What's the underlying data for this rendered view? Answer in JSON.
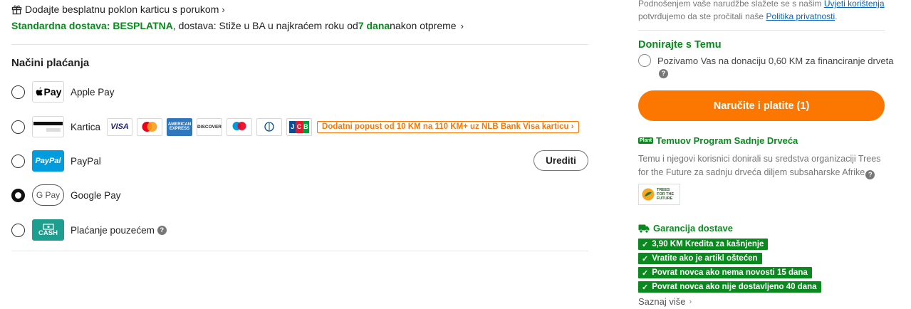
{
  "gift": {
    "label": "Dodajte besplatnu poklon karticu s porukom",
    "chevron": "›"
  },
  "shipping": {
    "prefix": "Standardna dostava: BESPLATNA",
    "middle": ", dostava: Stiže u BA u najkraćem roku od ",
    "days": "7 dana",
    "suffix": " nakon otpreme"
  },
  "payment": {
    "title": "Načini plaćanja",
    "methods": [
      {
        "label": "Apple Pay",
        "logo_text": "Pay",
        "icon": "apple-pay-icon",
        "selected": false
      },
      {
        "label": "Kartica",
        "icon": "card-icon",
        "selected": false
      },
      {
        "label": "PayPal",
        "logo_text": "PayPal",
        "icon": "paypal-icon",
        "selected": false
      },
      {
        "label": "Google Pay",
        "logo_text": "G Pay",
        "icon": "google-pay-icon",
        "selected": true
      },
      {
        "label": "Plaćanje pouzećem",
        "logo_text": "CASH",
        "icon": "cash-icon",
        "selected": false
      }
    ],
    "card_brands": [
      {
        "name": "VISA",
        "icon": "visa-icon"
      },
      {
        "name": "mastercard",
        "icon": "mastercard-icon"
      },
      {
        "name": "AMERICAN EXPRESS",
        "icon": "amex-icon"
      },
      {
        "name": "DISCOVER",
        "icon": "discover-icon"
      },
      {
        "name": "maestro",
        "icon": "maestro-icon"
      },
      {
        "name": "Diners Club",
        "icon": "diners-icon"
      },
      {
        "name": "JCB",
        "icon": "jcb-icon"
      }
    ],
    "card_promo": "Dodatni popust od 10 KM na 110 KM+ uz NLB Bank Visa karticu ›",
    "paypal_edit": "Urediti"
  },
  "terms": {
    "line1": "Podnošenjem vaše narudžbe slažete se s našim ",
    "link1": "Uvjeti korištenja",
    "line2": "potvrđujemo da ste pročitali naše ",
    "link2": "Politika privatnosti",
    "end": "."
  },
  "donate": {
    "title": "Donirajte s Temu",
    "text": "Pozivamo Vas na donaciju 0,60 KM za financiranje drveta"
  },
  "order_button": "Naručite i platite (1)",
  "program": {
    "badge": "Plant",
    "title": "Temuov Program Sadnje Drveća",
    "description": "Temu i njegovi korisnici donirali su sredstva organizaciji Trees for the Future za sadnju drveća diljem subsaharske Afrike",
    "logo_text": [
      "TREES",
      "FOR THE",
      "FUTURE"
    ]
  },
  "guarantee": {
    "title": "Garancija dostave",
    "items": [
      "3,90 KM Kredita za kašnjenje",
      "Vratite ako je artikl oštećen",
      "Povrat novca ako nema novosti 15 dana",
      "Povrat novca ako nije dostavljeno 40 dana"
    ],
    "more": "Saznaj više"
  },
  "colors": {
    "green": "#0a8a1e",
    "orange": "#fb7701",
    "link": "#0a64bc"
  }
}
